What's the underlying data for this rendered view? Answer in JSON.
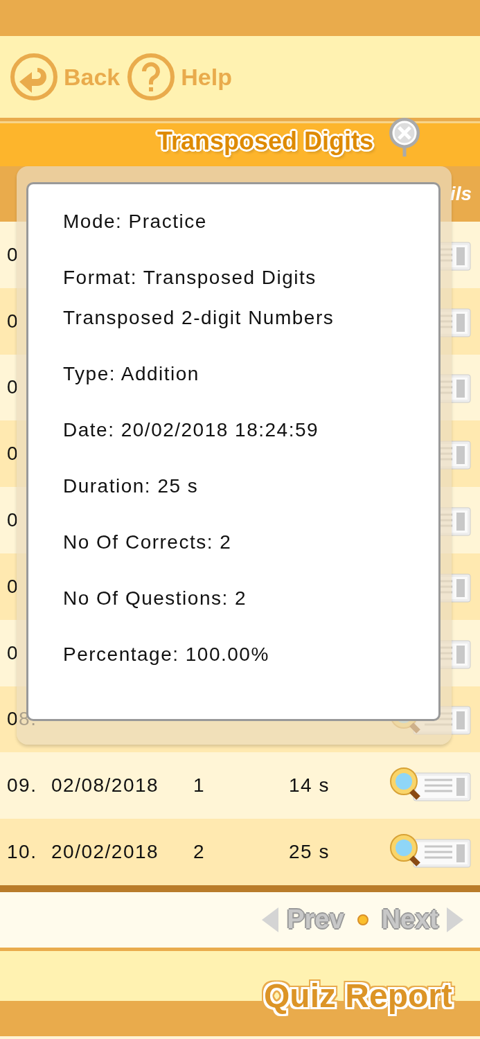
{
  "toolbar": {
    "back": "Back",
    "help": "Help"
  },
  "title_bar": {
    "title": "Transposed Digits"
  },
  "table": {
    "header_fragment": "ils",
    "rows": [
      {
        "index": "0"
      },
      {
        "index": "0"
      },
      {
        "index": "0"
      },
      {
        "index": "0"
      },
      {
        "index": "0"
      },
      {
        "index": "0"
      },
      {
        "index": "0"
      },
      {
        "index": "08."
      },
      {
        "index": "09.",
        "date": "02/08/2018",
        "correct": "1",
        "duration": "14 s"
      },
      {
        "index": "10.",
        "date": "20/02/2018",
        "correct": "2",
        "duration": "25 s"
      }
    ]
  },
  "popup": {
    "lines": [
      {
        "kind": "field",
        "text": "Mode: Practice"
      },
      {
        "kind": "field",
        "text": "Format: Transposed Digits"
      },
      {
        "kind": "subline",
        "text": "Transposed 2-digit Numbers"
      },
      {
        "kind": "field",
        "text": "Type: Addition"
      },
      {
        "kind": "field",
        "text": "Date: 20/02/2018 18:24:59"
      },
      {
        "kind": "field",
        "text": "Duration: 25 s"
      },
      {
        "kind": "field",
        "text": "No Of Corrects: 2"
      },
      {
        "kind": "field",
        "text": "No Of Questions: 2"
      },
      {
        "kind": "field",
        "text": "Percentage: 100.00%"
      }
    ]
  },
  "pager": {
    "prev": {
      "label": "Prev",
      "disabled": true
    },
    "next": {
      "label": "Next",
      "disabled": true
    }
  },
  "footer": {
    "title": "Quiz Report"
  }
}
